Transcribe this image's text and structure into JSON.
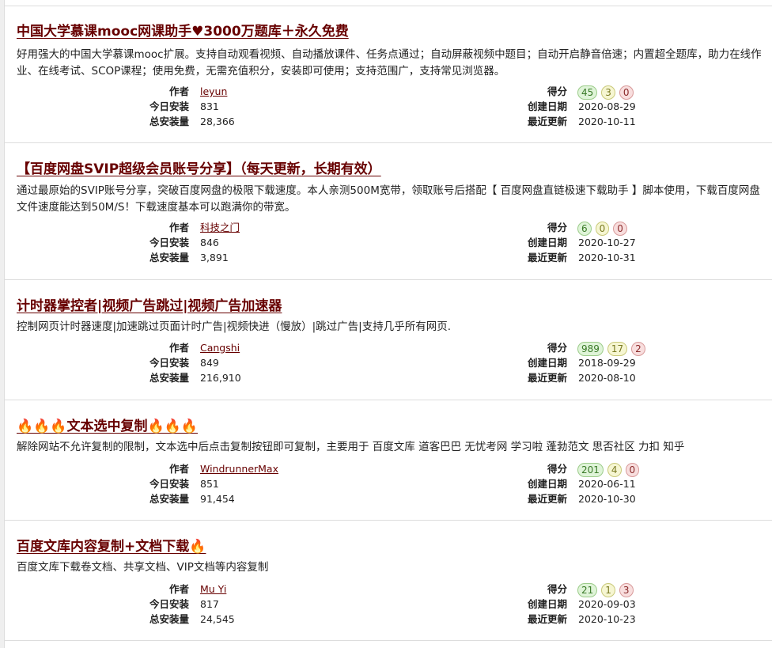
{
  "labels": {
    "author": "作者",
    "daily": "今日安装",
    "total": "总安装量",
    "score": "得分",
    "created": "创建日期",
    "updated": "最近更新"
  },
  "scripts": [
    {
      "title": "中国大学慕课mooc网课助手♥3000万题库＋永久免费",
      "desc": "好用强大的中国大学慕课mooc扩展。支持自动观看视频、自动播放课件、任务点通过；自动屏蔽视频中题目；自动开启静音倍速；内置超全题库，助力在线作业、在线考试、SCOP课程；使用免费，无需充值积分，安装即可使用；支持范围广，支持常见浏览器。",
      "author": "leyun",
      "daily": "831",
      "total": "28,366",
      "score_good": "45",
      "score_ok": "3",
      "score_bad": "0",
      "created": "2020-08-29",
      "updated": "2020-10-11"
    },
    {
      "title": "【百度网盘SVIP超级会员账号分享】（每天更新，长期有效）",
      "desc": "通过最原始的SVIP账号分享，突破百度网盘的极限下载速度。本人亲测500M宽带，领取账号后搭配【 百度网盘直链极速下载助手 】脚本使用，下载百度网盘文件速度能达到50M/S！下载速度基本可以跑满你的带宽。",
      "author": "科技之门",
      "daily": "846",
      "total": "3,891",
      "score_good": "6",
      "score_ok": "0",
      "score_bad": "0",
      "created": "2020-10-27",
      "updated": "2020-10-31"
    },
    {
      "title": "计时器掌控者|视频广告跳过|视频广告加速器",
      "desc": "控制网页计时器速度|加速跳过页面计时广告|视频快进（慢放）|跳过广告|支持几乎所有网页.",
      "author": "Cangshi",
      "daily": "849",
      "total": "216,910",
      "score_good": "989",
      "score_ok": "17",
      "score_bad": "2",
      "created": "2018-09-29",
      "updated": "2020-08-10"
    },
    {
      "title": "🔥🔥🔥文本选中复制🔥🔥🔥",
      "desc": "解除网站不允许复制的限制，文本选中后点击复制按钮即可复制，主要用于 百度文库 道客巴巴 无忧考网 学习啦 蓬勃范文 思否社区 力扣 知乎",
      "author": "WindrunnerMax",
      "daily": "851",
      "total": "91,454",
      "score_good": "201",
      "score_ok": "4",
      "score_bad": "0",
      "created": "2020-06-11",
      "updated": "2020-10-30"
    },
    {
      "title": "百度文库内容复制+文档下载🔥",
      "desc": "百度文库下载卷文档、共享文档、VIP文档等内容复制",
      "author": "Mu Yi",
      "daily": "817",
      "total": "24,545",
      "score_good": "21",
      "score_ok": "1",
      "score_bad": "3",
      "created": "2020-09-03",
      "updated": "2020-10-23"
    }
  ]
}
